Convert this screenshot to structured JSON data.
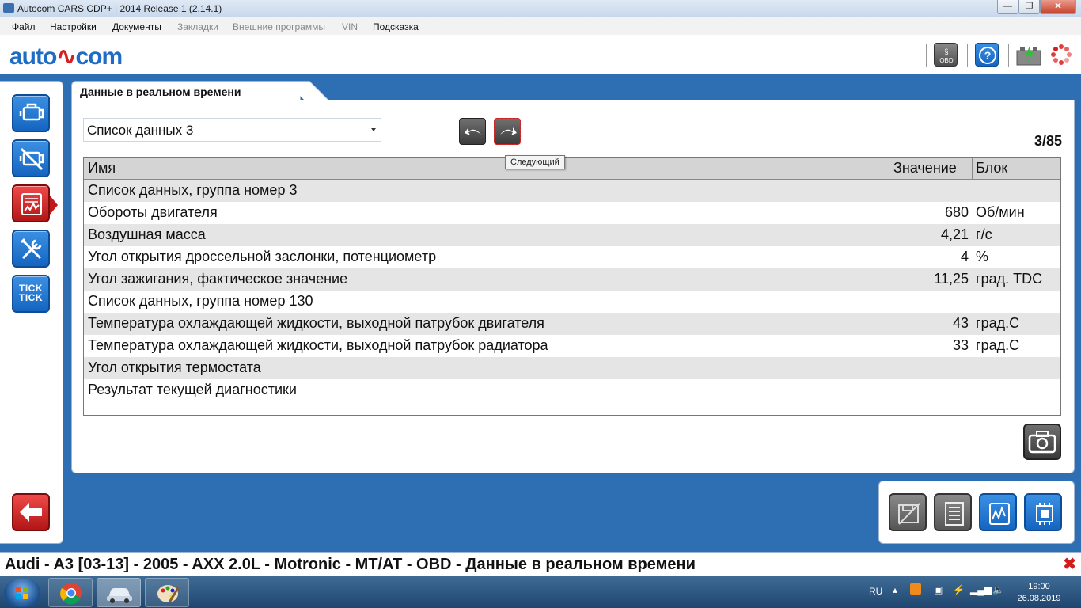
{
  "window": {
    "title": "Autocom CARS CDP+ | 2014 Release 1 (2.14.1)",
    "minimize_glyph": "—",
    "restore_glyph": "❐",
    "close_glyph": "✕"
  },
  "menu": {
    "items": [
      "Файл",
      "Настройки",
      "Документы",
      "Закладки",
      "Внешние программы",
      "VIN",
      "Подсказка"
    ],
    "disabled_items": [
      "Закладки",
      "Внешние программы",
      "VIN"
    ]
  },
  "toolbar": {
    "logo_left": "auto",
    "logo_right": "com",
    "obd_icon": "obd-law-icon",
    "help_icon": "help-icon",
    "battery_icon": "battery-charge-icon",
    "spinner_icon": "loading-spinner-icon"
  },
  "sidenav": {
    "items": [
      {
        "name": "engine",
        "icon": "engine-icon"
      },
      {
        "name": "fault-codes",
        "icon": "engine-crossed-icon"
      },
      {
        "name": "live-data",
        "icon": "live-data-icon",
        "active": true
      },
      {
        "name": "service",
        "icon": "tools-icon"
      },
      {
        "name": "tick-tick",
        "icon": "tick-tick-icon",
        "label": "TICK\nTICK"
      }
    ],
    "back_icon": "back-arrow-icon"
  },
  "tab": {
    "label": "Данные в реальном времени"
  },
  "list_select": {
    "value": "Список данных 3"
  },
  "nav_buttons": {
    "prev_icon": "arrow-back-icon",
    "next_icon": "arrow-forward-icon",
    "next_tooltip": "Следующий"
  },
  "page_counter": "3/85",
  "table": {
    "headers": {
      "name": "Имя",
      "value": "Значение",
      "unit": "Блок"
    },
    "rows": [
      {
        "name": "Список данных, группа номер 3",
        "value": "",
        "unit": ""
      },
      {
        "name": "Обороты двигателя",
        "value": "680",
        "unit": "Об/мин"
      },
      {
        "name": "Воздушная масса",
        "value": "4,21",
        "unit": "г/с"
      },
      {
        "name": "Угол открытия дроссельной заслонки, потенциометр",
        "value": "4",
        "unit": "%"
      },
      {
        "name": "Угол зажигания, фактическое значение",
        "value": "11,25",
        "unit": "град. TDC"
      },
      {
        "name": "Список данных, группа номер 130",
        "value": "",
        "unit": ""
      },
      {
        "name": "Температура охлаждающей жидкости, выходной патрубок двигателя",
        "value": "43",
        "unit": "град.С"
      },
      {
        "name": "Температура охлаждающей жидкости, выходной патрубок радиатора",
        "value": "33",
        "unit": "град.С"
      },
      {
        "name": "Угол открытия термостата",
        "value": "",
        "unit": ""
      },
      {
        "name": "Результат текущей диагностики",
        "value": "",
        "unit": ""
      }
    ]
  },
  "camera_icon": "camera-icon",
  "bottom_tools": [
    "save-disabled-icon",
    "list-icon",
    "graph-icon",
    "module-icon"
  ],
  "statusbar": {
    "text": "Audi - A3 [03-13] - 2005 - AXX 2.0L - Motronic - MT/AT - OBD - Данные в реальном времени",
    "close_glyph": "✖"
  },
  "taskbar": {
    "apps": [
      "chrome-icon",
      "autocom-car-icon",
      "paint-icon"
    ],
    "lang": "RU",
    "time": "19:00",
    "date": "26.08.2019"
  },
  "colors": {
    "accent": "#1565c0",
    "active_nav": "#c21a1a",
    "desktop": "#2e6fb4"
  }
}
